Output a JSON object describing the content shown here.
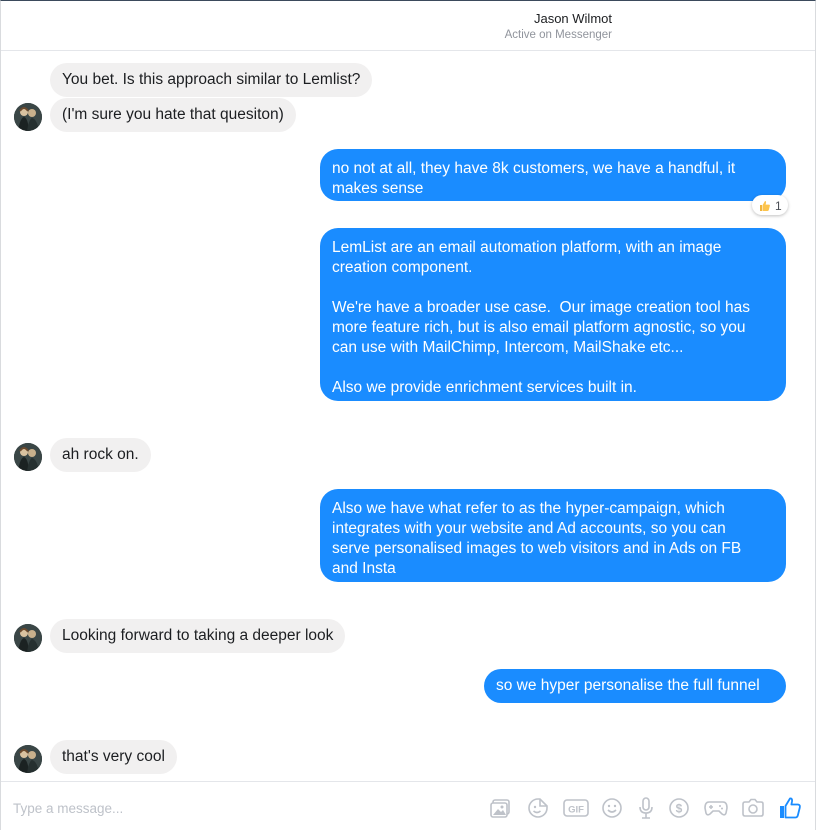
{
  "header": {
    "contact_name": "Jason Wilmot",
    "status": "Active on Messenger"
  },
  "messages": [
    {
      "from": "them",
      "text": "You bet. Is this approach similar to Lemlist?"
    },
    {
      "from": "them",
      "text": "(I'm sure you hate that quesiton)"
    },
    {
      "from": "me",
      "text": "no not at all, they have 8k customers, we have a handful, it\nmakes sense",
      "reaction": {
        "emoji": "thumbs-up",
        "count": "1"
      }
    },
    {
      "from": "me",
      "text": "LemList are an email automation platform, with an image\ncreation component.\n\nWe're have a broader use case.  Our image creation tool has\nmore feature rich, but is also email platform agnostic, so you\ncan use with MailChimp, Intercom, MailShake etc...\n\nAlso we provide enrichment services built in."
    },
    {
      "from": "them",
      "text": "ah rock on."
    },
    {
      "from": "me",
      "text": "Also we have what refer to as the hyper-campaign, which\nintegrates with your website and Ad accounts, so you can\nserve personalised images to web visitors and in Ads on FB\nand Insta"
    },
    {
      "from": "them",
      "text": "Looking forward to taking a deeper look"
    },
    {
      "from": "me",
      "text": "so we hyper personalise the full funnel"
    },
    {
      "from": "them",
      "text": "that's very cool"
    }
  ],
  "composer": {
    "placeholder": "Type a message...",
    "tools": [
      "photo-icon",
      "sticker-icon",
      "gif-icon",
      "emoji-icon",
      "microphone-icon",
      "payment-icon",
      "game-icon",
      "camera-icon",
      "like-icon"
    ]
  },
  "colors": {
    "outgoing_bubble": "#1a8cff",
    "incoming_bubble": "#f1f0f0",
    "like_button": "#1a8cff",
    "tool_icons": "#bec2c9"
  }
}
